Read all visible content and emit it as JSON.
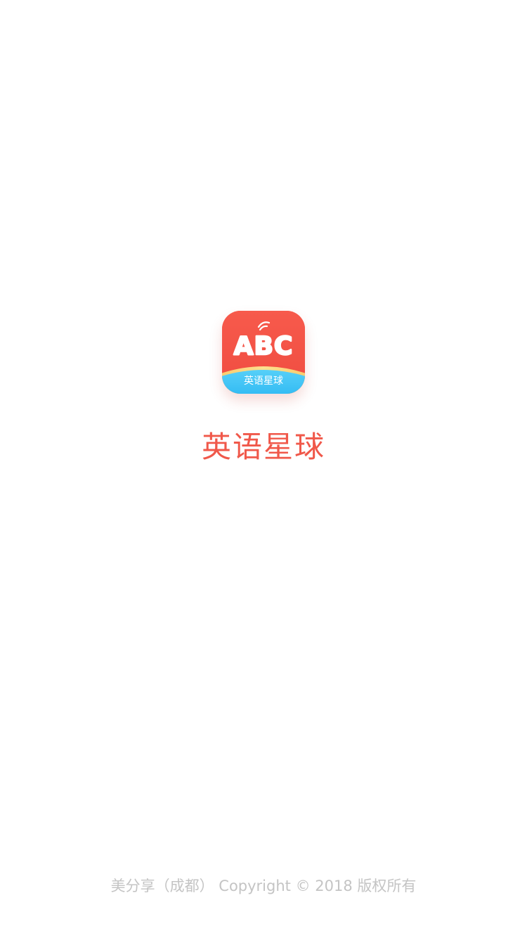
{
  "app": {
    "icon_letters": "ABC",
    "icon_label": "英语星球",
    "title": "英语星球"
  },
  "footer": {
    "copyright": "美分享（成都） Copyright © 2018 版权所有"
  },
  "colors": {
    "brand_red": "#f0584a",
    "icon_red": "#f4574a",
    "icon_blue": "#3fc3f5",
    "footer_gray": "#c4c4c4",
    "background": "#ffffff"
  }
}
